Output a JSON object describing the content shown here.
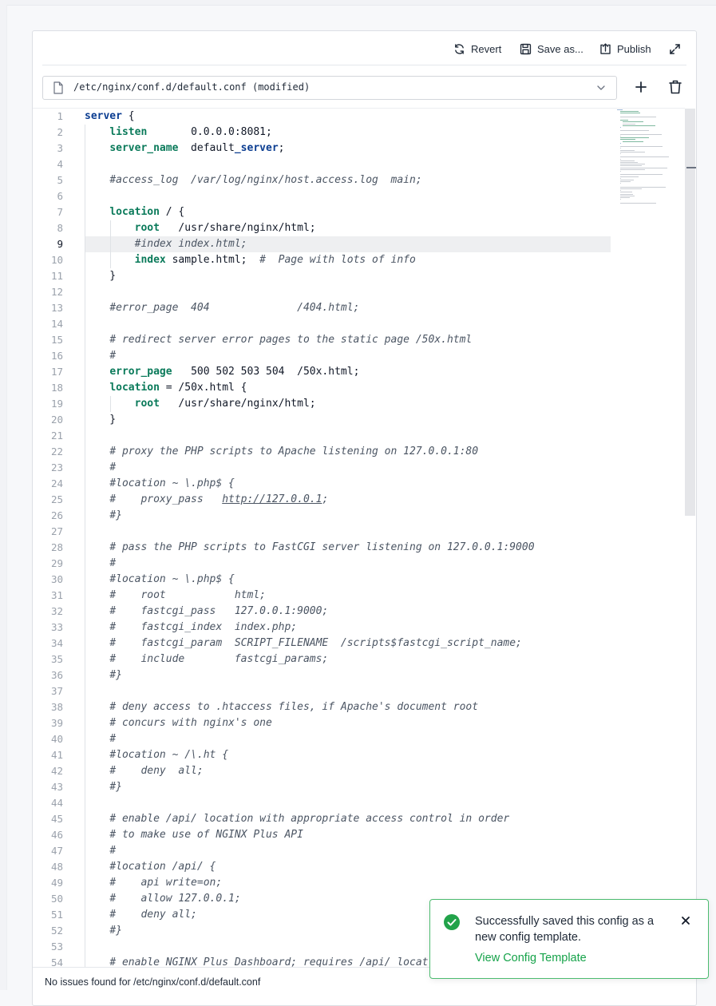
{
  "toolbar": {
    "revert_label": "Revert",
    "save_as_label": "Save as...",
    "publish_label": "Publish"
  },
  "file": {
    "path": "/etc/nginx/conf.d/default.conf (modified)"
  },
  "editor": {
    "active_line": 9,
    "lines": [
      [
        {
          "t": "server",
          "c": "kw"
        },
        {
          "t": " {"
        }
      ],
      [
        {
          "t": "    "
        },
        {
          "t": "listen",
          "c": "d"
        },
        {
          "t": "       0.0.0.0:8081;"
        }
      ],
      [
        {
          "t": "    "
        },
        {
          "t": "server_name",
          "c": "d"
        },
        {
          "t": "  default"
        },
        {
          "t": "_server",
          "c": "kw"
        },
        {
          "t": ";"
        }
      ],
      [],
      [
        {
          "t": "    "
        },
        {
          "t": "#access_log  /var/log/nginx/host.access.log  main;",
          "c": "cm"
        }
      ],
      [],
      [
        {
          "t": "    "
        },
        {
          "t": "location",
          "c": "d"
        },
        {
          "t": " / {"
        }
      ],
      [
        {
          "t": "        "
        },
        {
          "t": "root",
          "c": "d"
        },
        {
          "t": "   /usr/share/nginx/html;"
        }
      ],
      [
        {
          "t": "        "
        },
        {
          "t": "#index index.html;",
          "c": "cm"
        }
      ],
      [
        {
          "t": "        "
        },
        {
          "t": "index",
          "c": "d"
        },
        {
          "t": " sample.html;  "
        },
        {
          "t": "#  Page with lots of info",
          "c": "cm"
        }
      ],
      [
        {
          "t": "    }"
        }
      ],
      [],
      [
        {
          "t": "    "
        },
        {
          "t": "#error_page  404              /404.html;",
          "c": "cm"
        }
      ],
      [],
      [
        {
          "t": "    "
        },
        {
          "t": "# redirect server error pages to the static page /50x.html",
          "c": "cm"
        }
      ],
      [
        {
          "t": "    "
        },
        {
          "t": "#",
          "c": "cm"
        }
      ],
      [
        {
          "t": "    "
        },
        {
          "t": "error_page",
          "c": "d"
        },
        {
          "t": "   500 502 503 504  /50x.html;"
        }
      ],
      [
        {
          "t": "    "
        },
        {
          "t": "location",
          "c": "d"
        },
        {
          "t": " = /50x.html {"
        }
      ],
      [
        {
          "t": "        "
        },
        {
          "t": "root",
          "c": "d"
        },
        {
          "t": "   /usr/share/nginx/html;"
        }
      ],
      [
        {
          "t": "    }"
        }
      ],
      [],
      [
        {
          "t": "    "
        },
        {
          "t": "# proxy the PHP scripts to Apache listening on 127.0.0.1:80",
          "c": "cm"
        }
      ],
      [
        {
          "t": "    "
        },
        {
          "t": "#",
          "c": "cm"
        }
      ],
      [
        {
          "t": "    "
        },
        {
          "t": "#location ~ \\.php$ {",
          "c": "cm"
        }
      ],
      [
        {
          "t": "    "
        },
        {
          "t": "#    proxy_pass   ",
          "c": "cm"
        },
        {
          "t": "http://127.0.0.1",
          "c": "cm ul"
        },
        {
          "t": ";",
          "c": "cm"
        }
      ],
      [
        {
          "t": "    "
        },
        {
          "t": "#}",
          "c": "cm"
        }
      ],
      [],
      [
        {
          "t": "    "
        },
        {
          "t": "# pass the PHP scripts to FastCGI server listening on 127.0.0.1:9000",
          "c": "cm"
        }
      ],
      [
        {
          "t": "    "
        },
        {
          "t": "#",
          "c": "cm"
        }
      ],
      [
        {
          "t": "    "
        },
        {
          "t": "#location ~ \\.php$ {",
          "c": "cm"
        }
      ],
      [
        {
          "t": "    "
        },
        {
          "t": "#    root           html;",
          "c": "cm"
        }
      ],
      [
        {
          "t": "    "
        },
        {
          "t": "#    fastcgi_pass   127.0.0.1:9000;",
          "c": "cm"
        }
      ],
      [
        {
          "t": "    "
        },
        {
          "t": "#    fastcgi_index  index.php;",
          "c": "cm"
        }
      ],
      [
        {
          "t": "    "
        },
        {
          "t": "#    fastcgi_param  SCRIPT_FILENAME  /scripts$fastcgi_script_name;",
          "c": "cm"
        }
      ],
      [
        {
          "t": "    "
        },
        {
          "t": "#    include        fastcgi_params;",
          "c": "cm"
        }
      ],
      [
        {
          "t": "    "
        },
        {
          "t": "#}",
          "c": "cm"
        }
      ],
      [],
      [
        {
          "t": "    "
        },
        {
          "t": "# deny access to .htaccess files, if Apache's document root",
          "c": "cm"
        }
      ],
      [
        {
          "t": "    "
        },
        {
          "t": "# concurs with nginx's one",
          "c": "cm"
        }
      ],
      [
        {
          "t": "    "
        },
        {
          "t": "#",
          "c": "cm"
        }
      ],
      [
        {
          "t": "    "
        },
        {
          "t": "#location ~ /\\.ht {",
          "c": "cm"
        }
      ],
      [
        {
          "t": "    "
        },
        {
          "t": "#    deny  all;",
          "c": "cm"
        }
      ],
      [
        {
          "t": "    "
        },
        {
          "t": "#}",
          "c": "cm"
        }
      ],
      [],
      [
        {
          "t": "    "
        },
        {
          "t": "# enable /api/ location with appropriate access control in order",
          "c": "cm"
        }
      ],
      [
        {
          "t": "    "
        },
        {
          "t": "# to make use of NGINX Plus API",
          "c": "cm"
        }
      ],
      [
        {
          "t": "    "
        },
        {
          "t": "#",
          "c": "cm"
        }
      ],
      [
        {
          "t": "    "
        },
        {
          "t": "#location /api/ {",
          "c": "cm"
        }
      ],
      [
        {
          "t": "    "
        },
        {
          "t": "#    api write=on;",
          "c": "cm"
        }
      ],
      [
        {
          "t": "    "
        },
        {
          "t": "#    allow 127.0.0.1;",
          "c": "cm"
        }
      ],
      [
        {
          "t": "    "
        },
        {
          "t": "#    deny all;",
          "c": "cm"
        }
      ],
      [
        {
          "t": "    "
        },
        {
          "t": "#}",
          "c": "cm"
        }
      ],
      [],
      [
        {
          "t": "    "
        },
        {
          "t": "# enable NGINX Plus Dashboard; requires /api/ locat",
          "c": "cm"
        }
      ]
    ]
  },
  "status": {
    "message": "No issues found for /etc/nginx/conf.d/default.conf"
  },
  "toast": {
    "message": "Successfully saved this config as a new config template.",
    "link": "View Config Template"
  },
  "colors": {
    "keyword": "#0b3d91",
    "directive": "#0a7a5a",
    "comment": "#4b5563",
    "success": "#16a34a"
  }
}
